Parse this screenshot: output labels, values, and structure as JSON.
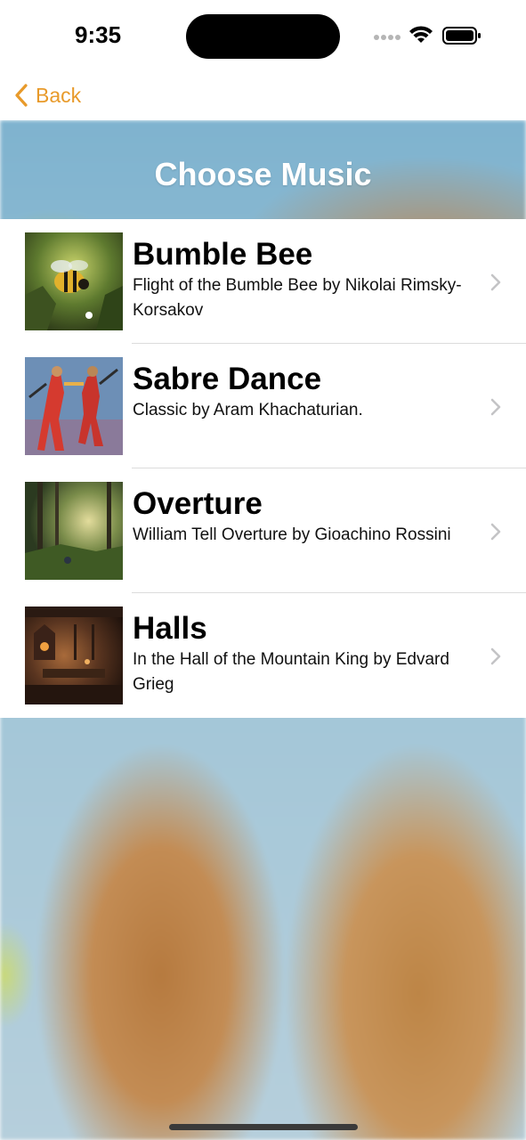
{
  "status_bar": {
    "time": "9:35"
  },
  "nav": {
    "back_label": "Back"
  },
  "header": {
    "title": "Choose Music"
  },
  "colors": {
    "accent": "#e89a2a"
  },
  "music_list": [
    {
      "title": "Bumble Bee",
      "subtitle": "Flight of the Bumble Bee by Nikolai Rimsky-Korsakov",
      "thumbnail": "bumble-bee-painting"
    },
    {
      "title": "Sabre Dance",
      "subtitle": "Classic by Aram Khachaturian.",
      "thumbnail": "sabre-dancers-painting"
    },
    {
      "title": "Overture",
      "subtitle": "William Tell Overture by Gioachino Rossini",
      "thumbnail": "forest-painting"
    },
    {
      "title": "Halls",
      "subtitle": "In the Hall of the Mountain King by Edvard Grieg",
      "thumbnail": "mountain-hall-painting"
    }
  ]
}
